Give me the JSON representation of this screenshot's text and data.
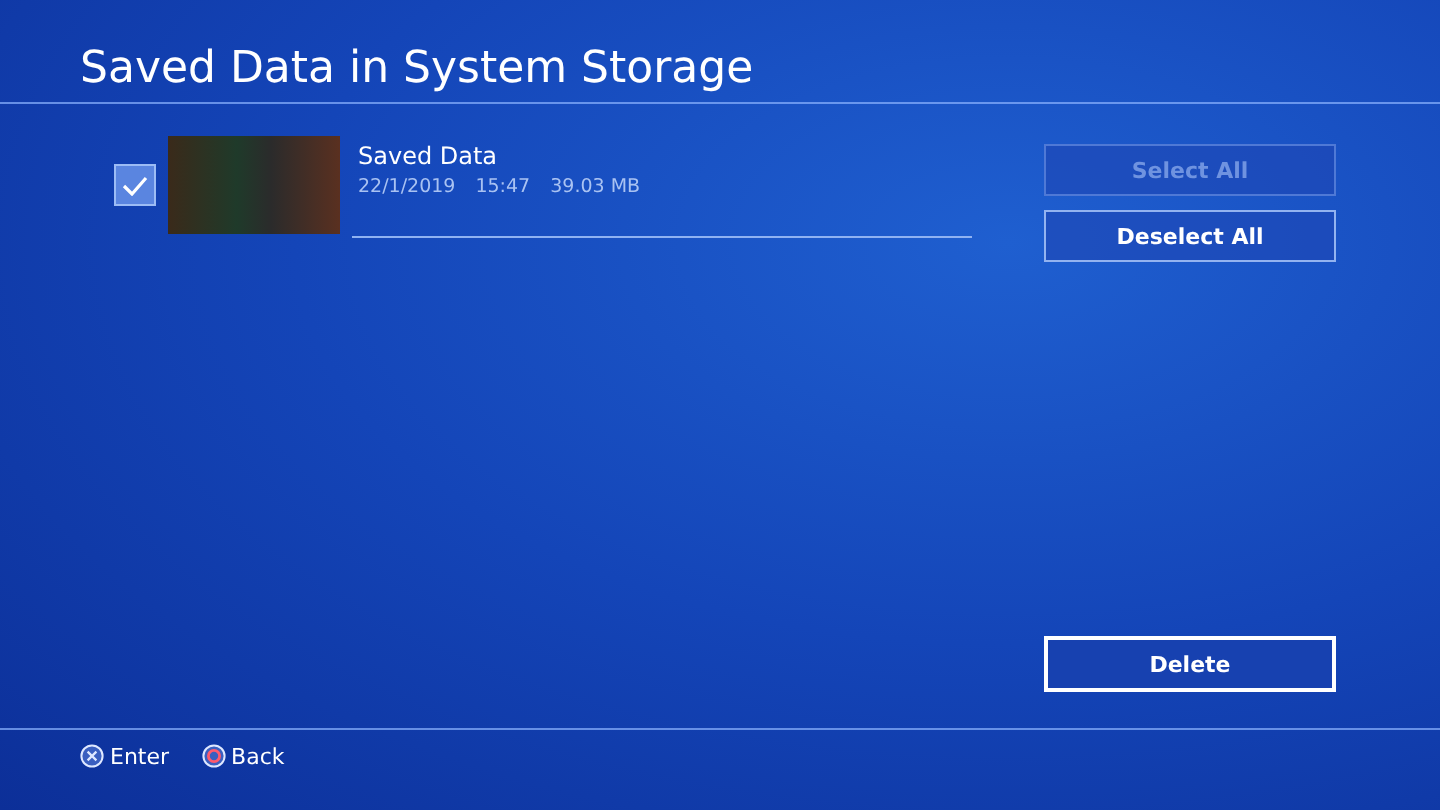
{
  "title": "Saved Data in System Storage",
  "items": [
    {
      "name": "Saved Data",
      "date": "22/1/2019",
      "time": "15:47",
      "size": "39.03 MB",
      "checked": true
    }
  ],
  "buttons": [
    {
      "label": "Select All",
      "disabled": true,
      "focused": false
    },
    {
      "label": "Deselect All",
      "disabled": false,
      "focused": false
    }
  ],
  "action_button": {
    "label": "Delete",
    "focused": true
  },
  "hints": [
    {
      "kind": "cross",
      "label": "Enter"
    },
    {
      "kind": "circle",
      "label": "Back"
    }
  ]
}
